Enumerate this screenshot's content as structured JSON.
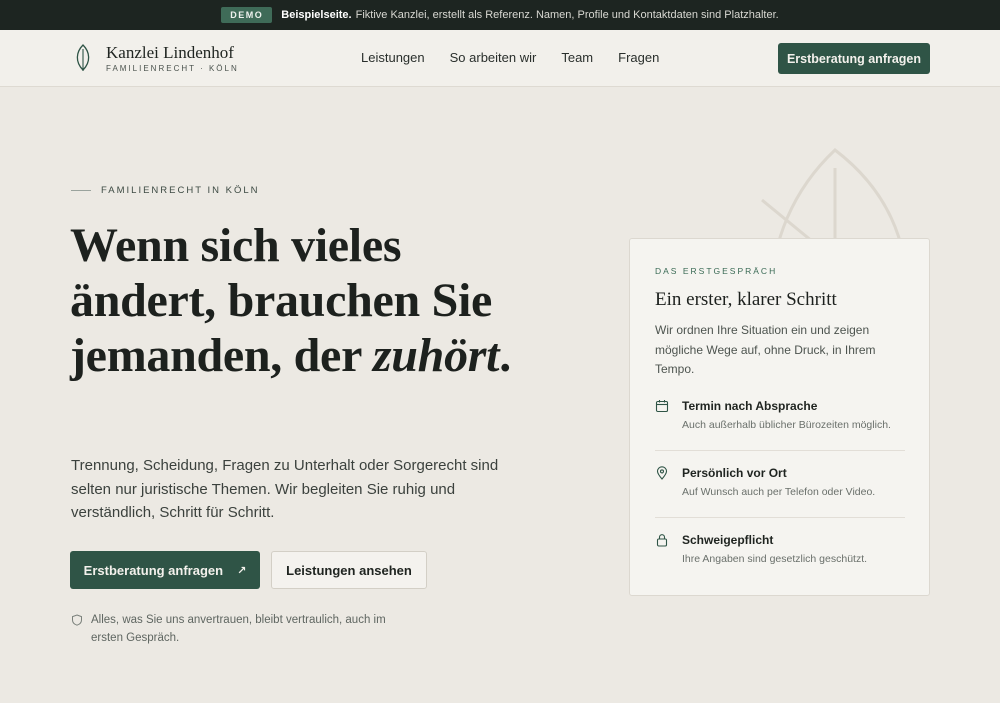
{
  "demo_bar": {
    "badge": "DEMO",
    "strong": "Beispielseite.",
    "text": "Fiktive Kanzlei, erstellt als Referenz. Namen, Profile und Kontaktdaten sind Platzhalter."
  },
  "header": {
    "brand_name": "Kanzlei Lindenhof",
    "brand_sub": "FAMILIENRECHT · KÖLN",
    "nav": [
      "Leistungen",
      "So arbeiten wir",
      "Team",
      "Fragen"
    ],
    "cta": "Erstberatung anfragen"
  },
  "hero": {
    "eyebrow": "FAMILIENRECHT IN KÖLN",
    "headline_main": "Wenn sich vieles ändert, brauchen Sie jemanden, der",
    "headline_em": "zuhört",
    "headline_end": ".",
    "lead": "Trennung, Scheidung, Fragen zu Unterhalt oder Sorgerecht sind selten nur juristische Themen. Wir begleiten Sie ruhig und verständlich, Schritt für Schritt.",
    "primary_button": "Erstberatung anfragen",
    "primary_button_arrow": "↗",
    "secondary_button": "Leistungen ansehen",
    "note": "Alles, was Sie uns anvertrauen, bleibt vertraulich, auch im ersten Gespräch."
  },
  "card": {
    "eyebrow": "DAS ERSTGESPRÄCH",
    "title": "Ein erster, klarer Schritt",
    "description": "Wir ordnen Ihre Situation ein und zeigen mögliche Wege auf, ohne Druck, in Ihrem Tempo.",
    "features": [
      {
        "icon": "calendar-icon",
        "title": "Termin nach Absprache",
        "desc": "Auch außerhalb üblicher Bürozeiten möglich."
      },
      {
        "icon": "location-pin-icon",
        "title": "Persönlich vor Ort",
        "desc": "Auf Wunsch auch per Telefon oder Video."
      },
      {
        "icon": "lock-icon",
        "title": "Schweigepflicht",
        "desc": "Ihre Angaben sind gesetzlich geschützt."
      }
    ]
  },
  "colors": {
    "accent": "#2f5446",
    "background": "#ece9e3",
    "demo_bar": "#1d2521"
  }
}
